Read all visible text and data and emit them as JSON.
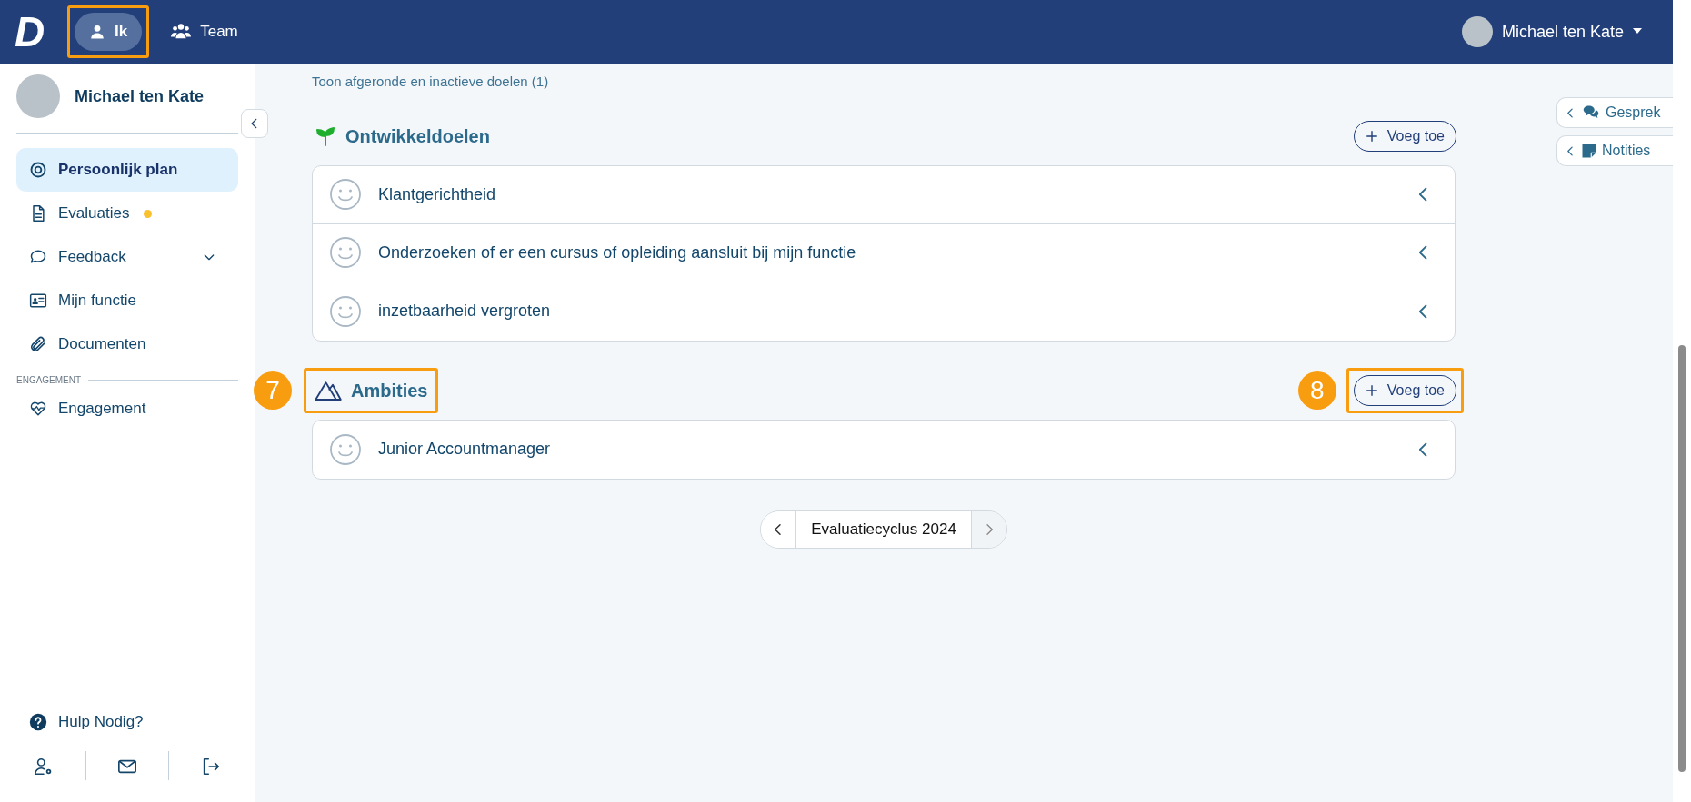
{
  "navbar": {
    "logo": "D",
    "tabs": [
      {
        "label": "Ik",
        "kind": "person",
        "selected": true,
        "highlighted": true
      },
      {
        "label": "Team",
        "kind": "people",
        "selected": false,
        "highlighted": false
      }
    ],
    "user": {
      "name": "Michael ten Kate"
    }
  },
  "sidebar": {
    "profile_name": "Michael ten Kate",
    "items": [
      {
        "label": "Persoonlijk plan",
        "kind": "target",
        "selected": true,
        "dot": false,
        "expandable": false
      },
      {
        "label": "Evaluaties",
        "kind": "document",
        "selected": false,
        "dot": true,
        "expandable": false
      },
      {
        "label": "Feedback",
        "kind": "chat",
        "selected": false,
        "dot": false,
        "expandable": true
      },
      {
        "label": "Mijn functie",
        "kind": "idcard",
        "selected": false,
        "dot": false,
        "expandable": false
      },
      {
        "label": "Documenten",
        "kind": "paperclip",
        "selected": false,
        "dot": false,
        "expandable": false
      }
    ],
    "section_label": "ENGAGEMENT",
    "section_items": [
      {
        "label": "Engagement",
        "kind": "heart",
        "selected": false,
        "dot": false,
        "expandable": false
      }
    ],
    "help": "Hulp Nodig?"
  },
  "show_inactive_link": "Toon afgeronde en inactieve doelen (1)",
  "sections": [
    {
      "title": "Ontwikkeldoelen",
      "kind": "sprout",
      "highlighted": false,
      "add_button": {
        "label": "Voeg toe",
        "highlighted": false
      },
      "goals": [
        {
          "title": "Klantgerichtheid"
        },
        {
          "title": "Onderzoeken of er een cursus of opleiding aansluit bij mijn functie"
        },
        {
          "title": "inzetbaarheid vergroten"
        }
      ]
    },
    {
      "title": "Ambities",
      "kind": "mountain",
      "highlighted": true,
      "callout": "7",
      "add_button": {
        "label": "Voeg toe",
        "highlighted": true,
        "callout": "8"
      },
      "goals": [
        {
          "title": "Junior Accountmanager"
        }
      ]
    }
  ],
  "pager": {
    "label": "Evaluatiecyclus 2024",
    "prev_disabled": false,
    "next_disabled": true
  },
  "side_tabs": [
    {
      "label": "Gesprek",
      "kind": "chat"
    },
    {
      "label": "Notities",
      "kind": "note"
    }
  ]
}
